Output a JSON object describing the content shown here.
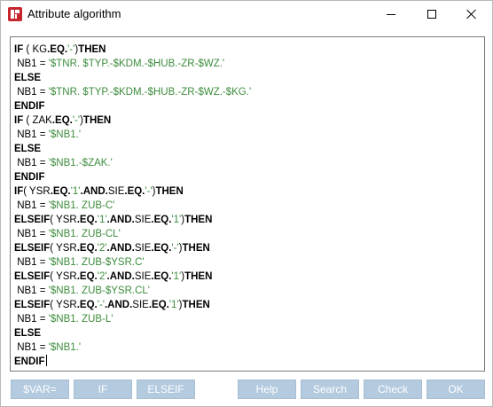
{
  "window": {
    "title": "Attribute algorithm",
    "app_icon": "app-logo-icon",
    "controls": [
      "minimize-icon",
      "maximize-icon",
      "close-icon"
    ]
  },
  "editor": {
    "lines": [
      [
        {
          "t": "kw",
          "v": "IF"
        },
        {
          "t": "id",
          "v": " ( KG"
        },
        {
          "t": "op",
          "v": ".EQ."
        },
        {
          "t": "str",
          "v": "'-'"
        },
        {
          "t": "id",
          "v": ")"
        },
        {
          "t": "kw",
          "v": "THEN"
        }
      ],
      [
        {
          "t": "id",
          "v": " NB1 = "
        },
        {
          "t": "str",
          "v": "'$TNR. $TYP.-$KDM.-$HUB.-ZR-$WZ.'"
        }
      ],
      [
        {
          "t": "kw",
          "v": "ELSE"
        }
      ],
      [
        {
          "t": "id",
          "v": " NB1 = "
        },
        {
          "t": "str",
          "v": "'$TNR. $TYP.-$KDM.-$HUB.-ZR-$WZ.-$KG.'"
        }
      ],
      [
        {
          "t": "kw",
          "v": "ENDIF"
        }
      ],
      [
        {
          "t": "kw",
          "v": "IF"
        },
        {
          "t": "id",
          "v": " ( ZAK"
        },
        {
          "t": "op",
          "v": ".EQ."
        },
        {
          "t": "str",
          "v": "'-'"
        },
        {
          "t": "id",
          "v": ")"
        },
        {
          "t": "kw",
          "v": "THEN"
        }
      ],
      [
        {
          "t": "id",
          "v": " NB1 = "
        },
        {
          "t": "str",
          "v": "'$NB1.'"
        }
      ],
      [
        {
          "t": "kw",
          "v": "ELSE"
        }
      ],
      [
        {
          "t": "id",
          "v": " NB1 = "
        },
        {
          "t": "str",
          "v": "'$NB1.-$ZAK.'"
        }
      ],
      [
        {
          "t": "kw",
          "v": "ENDIF"
        }
      ],
      [
        {
          "t": "kw",
          "v": "IF"
        },
        {
          "t": "id",
          "v": "( YSR"
        },
        {
          "t": "op",
          "v": ".EQ."
        },
        {
          "t": "str",
          "v": "'1'"
        },
        {
          "t": "op",
          "v": ".AND."
        },
        {
          "t": "id",
          "v": "SIE"
        },
        {
          "t": "op",
          "v": ".EQ."
        },
        {
          "t": "str",
          "v": "'-'"
        },
        {
          "t": "id",
          "v": ")"
        },
        {
          "t": "kw",
          "v": "THEN"
        }
      ],
      [
        {
          "t": "id",
          "v": " NB1 = "
        },
        {
          "t": "str",
          "v": "'$NB1. ZUB-C'"
        }
      ],
      [
        {
          "t": "kw",
          "v": "ELSEIF"
        },
        {
          "t": "id",
          "v": "( YSR"
        },
        {
          "t": "op",
          "v": ".EQ."
        },
        {
          "t": "str",
          "v": "'1'"
        },
        {
          "t": "op",
          "v": ".AND."
        },
        {
          "t": "id",
          "v": "SIE"
        },
        {
          "t": "op",
          "v": ".EQ."
        },
        {
          "t": "str",
          "v": "'1'"
        },
        {
          "t": "id",
          "v": ")"
        },
        {
          "t": "kw",
          "v": "THEN"
        }
      ],
      [
        {
          "t": "id",
          "v": " NB1 = "
        },
        {
          "t": "str",
          "v": "'$NB1. ZUB-CL'"
        }
      ],
      [
        {
          "t": "kw",
          "v": "ELSEIF"
        },
        {
          "t": "id",
          "v": "( YSR"
        },
        {
          "t": "op",
          "v": ".EQ."
        },
        {
          "t": "str",
          "v": "'2'"
        },
        {
          "t": "op",
          "v": ".AND."
        },
        {
          "t": "id",
          "v": "SIE"
        },
        {
          "t": "op",
          "v": ".EQ."
        },
        {
          "t": "str",
          "v": "'-'"
        },
        {
          "t": "id",
          "v": ")"
        },
        {
          "t": "kw",
          "v": "THEN"
        }
      ],
      [
        {
          "t": "id",
          "v": " NB1 = "
        },
        {
          "t": "str",
          "v": "'$NB1. ZUB-$YSR.C'"
        }
      ],
      [
        {
          "t": "kw",
          "v": "ELSEIF"
        },
        {
          "t": "id",
          "v": "( YSR"
        },
        {
          "t": "op",
          "v": ".EQ."
        },
        {
          "t": "str",
          "v": "'2'"
        },
        {
          "t": "op",
          "v": ".AND."
        },
        {
          "t": "id",
          "v": "SIE"
        },
        {
          "t": "op",
          "v": ".EQ."
        },
        {
          "t": "str",
          "v": "'1'"
        },
        {
          "t": "id",
          "v": ")"
        },
        {
          "t": "kw",
          "v": "THEN"
        }
      ],
      [
        {
          "t": "id",
          "v": " NB1 = "
        },
        {
          "t": "str",
          "v": "'$NB1. ZUB-$YSR.CL'"
        }
      ],
      [
        {
          "t": "kw",
          "v": "ELSEIF"
        },
        {
          "t": "id",
          "v": "( YSR"
        },
        {
          "t": "op",
          "v": ".EQ."
        },
        {
          "t": "str",
          "v": "'-'"
        },
        {
          "t": "op",
          "v": ".AND."
        },
        {
          "t": "id",
          "v": "SIE"
        },
        {
          "t": "op",
          "v": ".EQ."
        },
        {
          "t": "str",
          "v": "'1'"
        },
        {
          "t": "id",
          "v": ")"
        },
        {
          "t": "kw",
          "v": "THEN"
        }
      ],
      [
        {
          "t": "id",
          "v": " NB1 = "
        },
        {
          "t": "str",
          "v": "'$NB1. ZUB-L'"
        }
      ],
      [
        {
          "t": "kw",
          "v": "ELSE"
        }
      ],
      [
        {
          "t": "id",
          "v": " NB1 = "
        },
        {
          "t": "str",
          "v": "'$NB1.'"
        }
      ],
      [
        {
          "t": "kw",
          "v": "ENDIF"
        }
      ]
    ],
    "colors": {
      "keyword": "#000000",
      "string": "#3c8c3c",
      "identifier": "#000000"
    }
  },
  "buttons": {
    "var": "$VAR=",
    "if": "IF",
    "elseif": "ELSEIF",
    "help": "Help",
    "search": "Search",
    "check": "Check",
    "ok": "OK",
    "disabled_color": "#b3cadf"
  }
}
